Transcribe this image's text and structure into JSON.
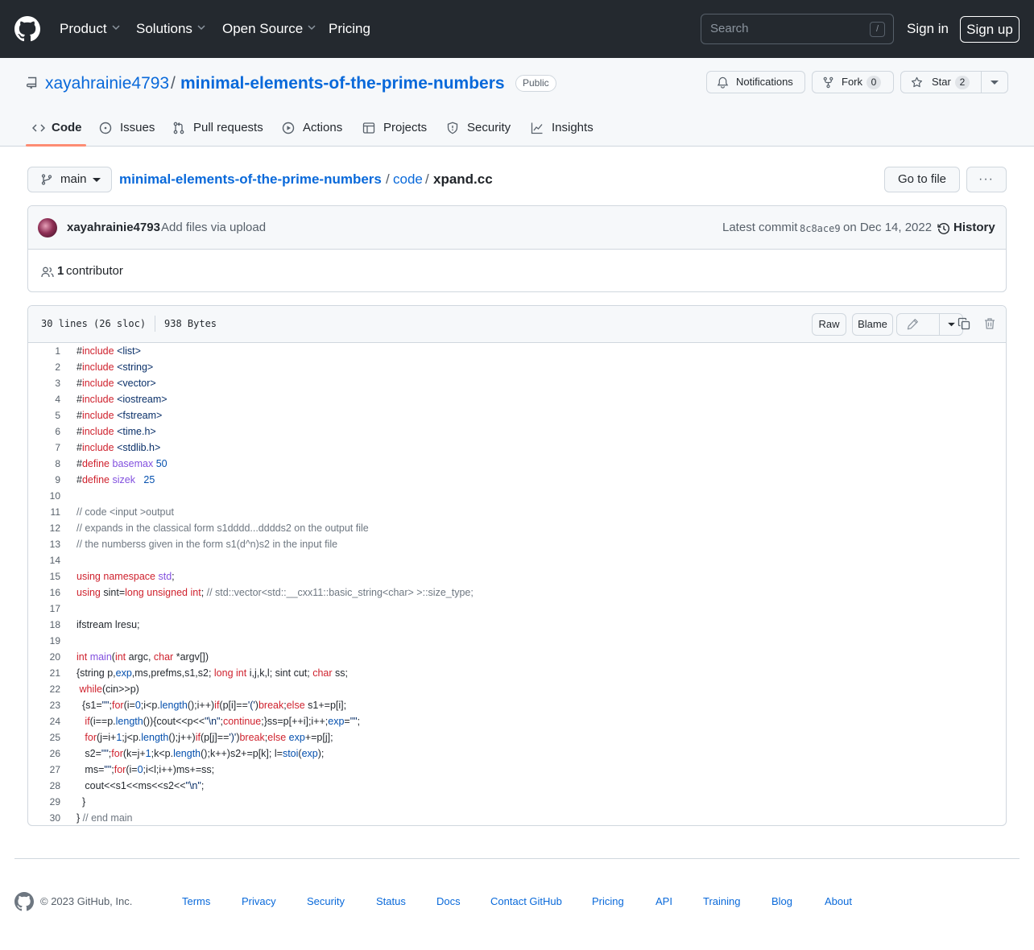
{
  "header": {
    "nav": [
      "Product",
      "Solutions",
      "Open Source",
      "Pricing"
    ],
    "search_placeholder": "Search",
    "search_key": "/",
    "signin": "Sign in",
    "signup": "Sign up"
  },
  "repo": {
    "owner": "xayahrainie4793",
    "separator": "/",
    "name": "minimal-elements-of-the-prime-numbers",
    "visibility": "Public",
    "notifications": "Notifications",
    "fork_label": "Fork",
    "fork_count": "0",
    "star_label": "Star",
    "star_count": "2",
    "tabs": [
      "Code",
      "Issues",
      "Pull requests",
      "Actions",
      "Projects",
      "Security",
      "Insights"
    ]
  },
  "breadcrumb": {
    "branch": "main",
    "repo": "minimal-elements-of-the-prime-numbers",
    "sep": "/",
    "folder": "code",
    "file": "xpand.cc",
    "goto": "Go to file",
    "more": "···"
  },
  "commit": {
    "author": "xayahrainie4793",
    "message": "Add files via upload",
    "latest_label": "Latest commit",
    "sha": "8c8ace9",
    "date": "on Dec 14, 2022",
    "history": "History",
    "contributors_count": "1",
    "contributors_label": "contributor"
  },
  "file": {
    "lines_info": "30 lines (26 sloc)",
    "size": "938 Bytes",
    "raw": "Raw",
    "blame": "Blame"
  },
  "code_lines": [
    [
      [
        "p",
        "#"
      ],
      [
        "k",
        "include"
      ],
      [
        "p",
        " "
      ],
      [
        "s",
        "<list>"
      ]
    ],
    [
      [
        "p",
        "#"
      ],
      [
        "k",
        "include"
      ],
      [
        "p",
        " "
      ],
      [
        "s",
        "<string>"
      ]
    ],
    [
      [
        "p",
        "#"
      ],
      [
        "k",
        "include"
      ],
      [
        "p",
        " "
      ],
      [
        "s",
        "<vector>"
      ]
    ],
    [
      [
        "p",
        "#"
      ],
      [
        "k",
        "include"
      ],
      [
        "p",
        " "
      ],
      [
        "s",
        "<iostream>"
      ]
    ],
    [
      [
        "p",
        "#"
      ],
      [
        "k",
        "include"
      ],
      [
        "p",
        " "
      ],
      [
        "s",
        "<fstream>"
      ]
    ],
    [
      [
        "p",
        "#"
      ],
      [
        "k",
        "include"
      ],
      [
        "p",
        " "
      ],
      [
        "s",
        "<time.h>"
      ]
    ],
    [
      [
        "p",
        "#"
      ],
      [
        "k",
        "include"
      ],
      [
        "p",
        " "
      ],
      [
        "s",
        "<stdlib.h>"
      ]
    ],
    [
      [
        "p",
        "#"
      ],
      [
        "k",
        "define"
      ],
      [
        "p",
        " "
      ],
      [
        "f",
        "basemax"
      ],
      [
        "p",
        " "
      ],
      [
        "n",
        "50"
      ]
    ],
    [
      [
        "p",
        "#"
      ],
      [
        "k",
        "define"
      ],
      [
        "p",
        " "
      ],
      [
        "f",
        "sizek"
      ],
      [
        "p",
        "   "
      ],
      [
        "n",
        "25"
      ]
    ],
    [],
    [
      [
        "c",
        "// code <input >output"
      ]
    ],
    [
      [
        "c",
        "// expands in the classical form s1dddd...dddds2 on the output file"
      ]
    ],
    [
      [
        "c",
        "// the numberss given in the form s1(d^n)s2 in the input file"
      ]
    ],
    [],
    [
      [
        "k",
        "using"
      ],
      [
        "p",
        " "
      ],
      [
        "k",
        "namespace"
      ],
      [
        "p",
        " "
      ],
      [
        "f",
        "std"
      ],
      [
        "p",
        ";"
      ]
    ],
    [
      [
        "k",
        "using"
      ],
      [
        "p",
        " sint="
      ],
      [
        "k",
        "long"
      ],
      [
        "p",
        " "
      ],
      [
        "k",
        "unsigned"
      ],
      [
        "p",
        " "
      ],
      [
        "k",
        "int"
      ],
      [
        "p",
        "; "
      ],
      [
        "c",
        "// std::vector<std::__cxx11::basic_string<char> >::size_type;"
      ]
    ],
    [],
    [
      [
        "p",
        "ifstream lresu;"
      ]
    ],
    [],
    [
      [
        "k",
        "int"
      ],
      [
        "p",
        " "
      ],
      [
        "f",
        "main"
      ],
      [
        "p",
        "("
      ],
      [
        "k",
        "int"
      ],
      [
        "p",
        " argc, "
      ],
      [
        "k",
        "char"
      ],
      [
        "p",
        " *argv[])"
      ]
    ],
    [
      [
        "p",
        "{string p,"
      ],
      [
        "n",
        "exp"
      ],
      [
        "p",
        ",ms,prefms,s1,s2; "
      ],
      [
        "k",
        "long"
      ],
      [
        "p",
        " "
      ],
      [
        "k",
        "int"
      ],
      [
        "p",
        " i,j,k,l; sint cut; "
      ],
      [
        "k",
        "char"
      ],
      [
        "p",
        " ss;"
      ]
    ],
    [
      [
        "p",
        " "
      ],
      [
        "k",
        "while"
      ],
      [
        "p",
        "(cin>>p)"
      ]
    ],
    [
      [
        "p",
        "  {s1="
      ],
      [
        "s",
        "\"\""
      ],
      [
        "p",
        ";"
      ],
      [
        "k",
        "for"
      ],
      [
        "p",
        "(i="
      ],
      [
        "n",
        "0"
      ],
      [
        "p",
        ";i<p."
      ],
      [
        "n",
        "length"
      ],
      [
        "p",
        "();i++)"
      ],
      [
        "k",
        "if"
      ],
      [
        "p",
        "(p[i]=="
      ],
      [
        "s",
        "'('"
      ],
      [
        "p",
        ")"
      ],
      [
        "k",
        "break"
      ],
      [
        "p",
        ";"
      ],
      [
        "k",
        "else"
      ],
      [
        "p",
        " s1+=p[i];"
      ]
    ],
    [
      [
        "p",
        "   "
      ],
      [
        "k",
        "if"
      ],
      [
        "p",
        "(i==p."
      ],
      [
        "n",
        "length"
      ],
      [
        "p",
        "()){cout<<p<<"
      ],
      [
        "s",
        "\"\\n\""
      ],
      [
        "p",
        ";"
      ],
      [
        "k",
        "continue"
      ],
      [
        "p",
        ";}ss=p[++i];i++;"
      ],
      [
        "n",
        "exp"
      ],
      [
        "p",
        "="
      ],
      [
        "s",
        "\"\""
      ],
      [
        "p",
        ";"
      ]
    ],
    [
      [
        "p",
        "   "
      ],
      [
        "k",
        "for"
      ],
      [
        "p",
        "(j=i+"
      ],
      [
        "n",
        "1"
      ],
      [
        "p",
        ";j<p."
      ],
      [
        "n",
        "length"
      ],
      [
        "p",
        "();j++)"
      ],
      [
        "k",
        "if"
      ],
      [
        "p",
        "(p[j]=="
      ],
      [
        "s",
        "')'"
      ],
      [
        "p",
        ")"
      ],
      [
        "k",
        "break"
      ],
      [
        "p",
        ";"
      ],
      [
        "k",
        "else"
      ],
      [
        "p",
        " "
      ],
      [
        "n",
        "exp"
      ],
      [
        "p",
        "+=p[j];"
      ]
    ],
    [
      [
        "p",
        "   s2="
      ],
      [
        "s",
        "\"\""
      ],
      [
        "p",
        ";"
      ],
      [
        "k",
        "for"
      ],
      [
        "p",
        "(k=j+"
      ],
      [
        "n",
        "1"
      ],
      [
        "p",
        ";k<p."
      ],
      [
        "n",
        "length"
      ],
      [
        "p",
        "();k++)s2+=p[k]; l="
      ],
      [
        "n",
        "stoi"
      ],
      [
        "p",
        "("
      ],
      [
        "n",
        "exp"
      ],
      [
        "p",
        ");"
      ]
    ],
    [
      [
        "p",
        "   ms="
      ],
      [
        "s",
        "\"\""
      ],
      [
        "p",
        ";"
      ],
      [
        "k",
        "for"
      ],
      [
        "p",
        "(i="
      ],
      [
        "n",
        "0"
      ],
      [
        "p",
        ";i<l;i++)ms+=ss;"
      ]
    ],
    [
      [
        "p",
        "   cout<<s1<<ms<<s2<<"
      ],
      [
        "s",
        "\"\\n\""
      ],
      [
        "p",
        ";"
      ]
    ],
    [
      [
        "p",
        "  }"
      ]
    ],
    [
      [
        "p",
        "} "
      ],
      [
        "c",
        "// end main"
      ]
    ]
  ],
  "footer": {
    "copyright": "© 2023 GitHub, Inc.",
    "links": [
      "Terms",
      "Privacy",
      "Security",
      "Status",
      "Docs",
      "Contact GitHub",
      "Pricing",
      "API",
      "Training",
      "Blog",
      "About"
    ]
  },
  "colors": {
    "header_bg": "#24292f",
    "link": "#0969da",
    "tab_underline": "#fd8c73",
    "keyword": "#cf222e",
    "string": "#0a3069",
    "entity": "#8250df",
    "comment": "#6e7781",
    "constant": "#0550ae"
  }
}
